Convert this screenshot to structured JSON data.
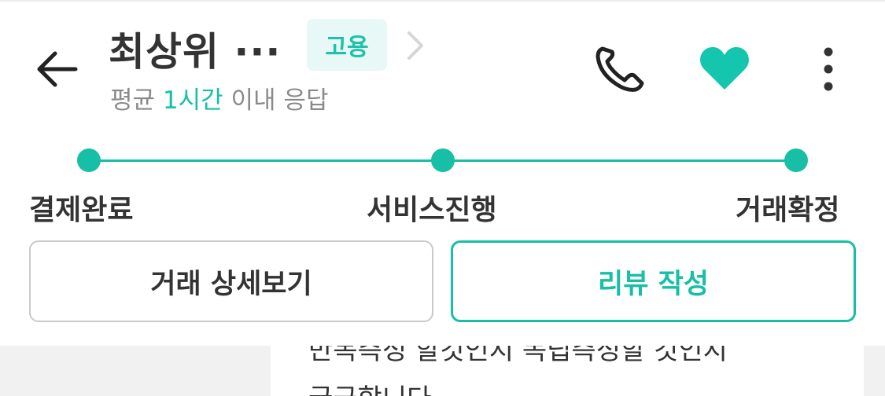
{
  "header": {
    "title": "최상위 ···",
    "tag": "고용",
    "subtitle_prefix": "평균 ",
    "subtitle_highlight": "1시간",
    "subtitle_suffix": " 이내 응답"
  },
  "icons": {
    "back": "arrow-left-icon",
    "chevron": "chevron-right-icon",
    "phone": "phone-icon",
    "favorite": "heart-icon",
    "more": "more-vertical-icon"
  },
  "colors": {
    "accent": "#16bfa5",
    "tag_bg": "#e8f8f6",
    "heart": "#13c6ad"
  },
  "progress": {
    "steps": [
      "결제완료",
      "서비스진행",
      "거래확정"
    ],
    "completed_steps": 3
  },
  "actions": {
    "detail_label": "거래 상세보기",
    "review_label": "리뷰 작성"
  },
  "message": {
    "line1": "반복측정 할것인지 독립측정할 것인지",
    "line2": "궁금합니다."
  }
}
